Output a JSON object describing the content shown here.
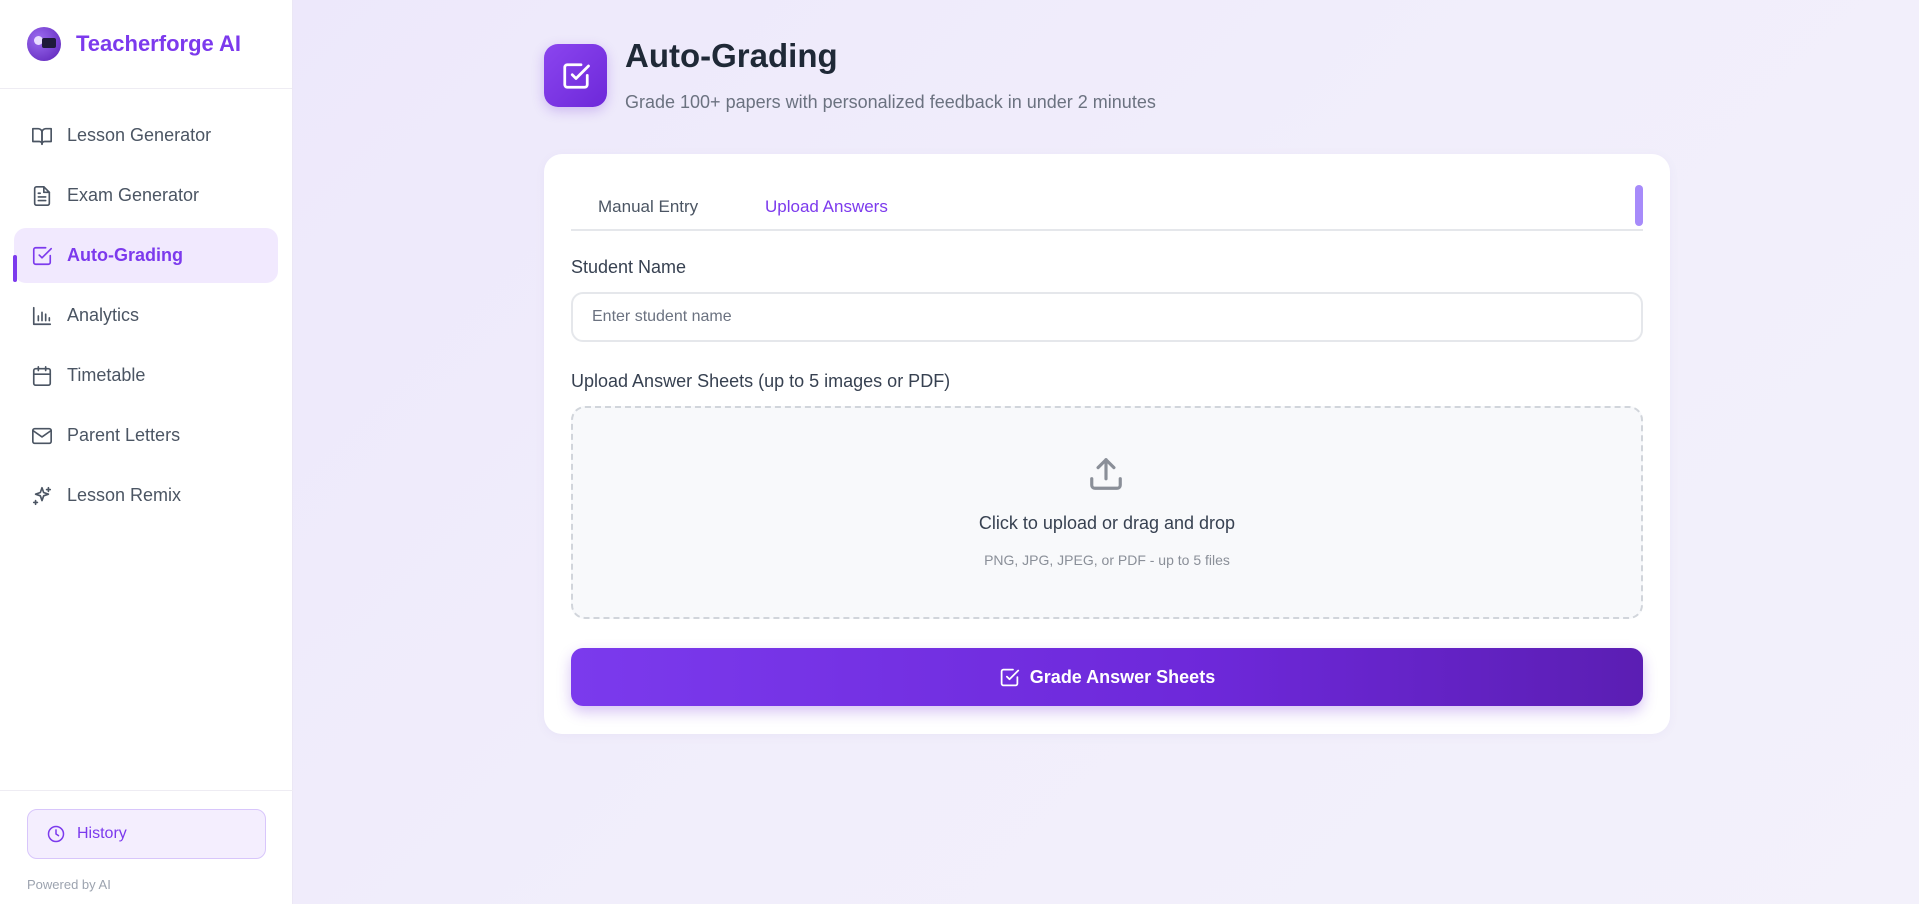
{
  "brand": {
    "name": "Teacherforge AI"
  },
  "sidebar": {
    "items": [
      {
        "label": "Lesson Generator",
        "icon": "book-open-icon"
      },
      {
        "label": "Exam Generator",
        "icon": "file-text-icon"
      },
      {
        "label": "Auto-Grading",
        "icon": "checkbox-icon",
        "active": true
      },
      {
        "label": "Analytics",
        "icon": "bar-chart-icon"
      },
      {
        "label": "Timetable",
        "icon": "calendar-icon"
      },
      {
        "label": "Parent Letters",
        "icon": "mail-icon"
      },
      {
        "label": "Lesson Remix",
        "icon": "sparkles-icon"
      }
    ],
    "history_label": "History",
    "powered_by": "Powered by AI"
  },
  "header": {
    "title": "Auto-Grading",
    "subtitle": "Grade 100+ papers with personalized feedback in under 2 minutes"
  },
  "tabs": [
    {
      "label": "Manual Entry",
      "active": false
    },
    {
      "label": "Upload Answers",
      "active": true
    }
  ],
  "form": {
    "student_name_label": "Student Name",
    "student_name_placeholder": "Enter student name",
    "student_name_value": "",
    "upload_label": "Upload Answer Sheets (up to 5 images or PDF)",
    "dropzone_title": "Click to upload or drag and drop",
    "dropzone_hint": "PNG, JPG, JPEG, or PDF - up to 5 files",
    "submit_label": "Grade Answer Sheets"
  },
  "colors": {
    "accent": "#7c3aed",
    "accent_light": "#f1e9fe",
    "background": "#ece7fb"
  }
}
